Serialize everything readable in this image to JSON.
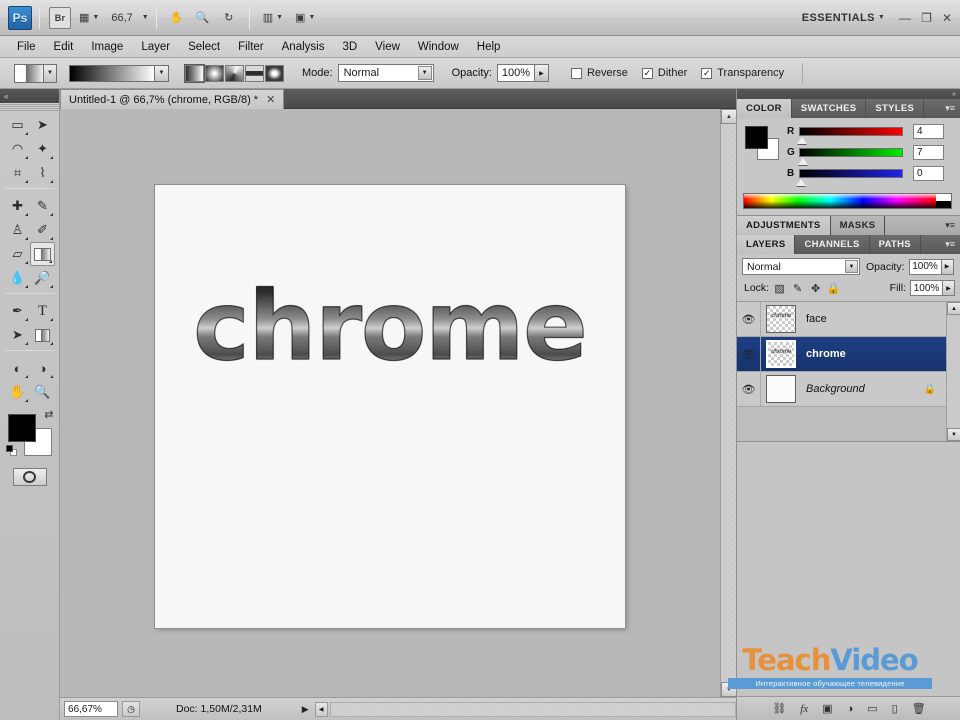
{
  "app": {
    "logo": "Ps",
    "bridge_button": "Br",
    "zoom_value": "66,7",
    "workspace": "ESSENTIALS",
    "window_controls": {
      "minimize": "—",
      "restore": "❐",
      "close": "✕"
    },
    "toolbar_icons": {
      "view_extras": "▦",
      "hand": "✋",
      "zoom": "🔍",
      "rotate": "↻",
      "arrange": "▥",
      "screen_mode": "▣"
    }
  },
  "menubar": {
    "items": [
      "File",
      "Edit",
      "Image",
      "Layer",
      "Select",
      "Filter",
      "Analysis",
      "3D",
      "View",
      "Window",
      "Help"
    ]
  },
  "options_bar": {
    "gradient_preset_label": "gradient-preset",
    "gradient_strip_label": "black-to-white-gradient",
    "gradient_types": [
      "linear",
      "radial",
      "angle",
      "reflected",
      "diamond"
    ],
    "gradient_type_selected": "linear",
    "mode_label": "Mode:",
    "mode_value": "Normal",
    "opacity_label": "Opacity:",
    "opacity_value": "100%",
    "checkboxes": [
      {
        "label": "Reverse",
        "checked": false
      },
      {
        "label": "Dither",
        "checked": true
      },
      {
        "label": "Transparency",
        "checked": true
      }
    ]
  },
  "document": {
    "tab_title": "Untitled-1 @ 66,7% (chrome, RGB/8) *",
    "close_glyph": "✕",
    "canvas_text": "chrome"
  },
  "toolbox": {
    "tools": [
      {
        "name": "rectangular-marquee",
        "glyph": "▭"
      },
      {
        "name": "move",
        "glyph": "➤"
      },
      {
        "name": "lasso",
        "glyph": "◠"
      },
      {
        "name": "magic-wand",
        "glyph": "✦"
      },
      {
        "name": "crop",
        "glyph": "⌗"
      },
      {
        "name": "eyedropper",
        "glyph": "⌇"
      },
      {
        "name": "healing-brush",
        "glyph": "✚"
      },
      {
        "name": "brush",
        "glyph": "✎"
      },
      {
        "name": "clone-stamp",
        "glyph": "♙"
      },
      {
        "name": "history-brush",
        "glyph": "✐"
      },
      {
        "name": "eraser",
        "glyph": "▱"
      },
      {
        "name": "gradient",
        "glyph": "▤"
      },
      {
        "name": "blur",
        "glyph": "💧"
      },
      {
        "name": "dodge",
        "glyph": "🔎"
      },
      {
        "name": "pen",
        "glyph": "✒"
      },
      {
        "name": "horizontal-type",
        "glyph": "T"
      },
      {
        "name": "path-selection",
        "glyph": "➤"
      },
      {
        "name": "rectangle-shape",
        "glyph": "▢"
      },
      {
        "name": "3d-rotate",
        "glyph": "◐"
      },
      {
        "name": "3d-orbit",
        "glyph": "◑"
      },
      {
        "name": "hand",
        "glyph": "✋"
      },
      {
        "name": "zoom",
        "glyph": "🔍"
      }
    ],
    "active_tool": "gradient",
    "foreground_color": "#000000",
    "background_color": "#ffffff",
    "swap_glyph": "⇄",
    "quick_mask_label": "quick-mask"
  },
  "color_panel": {
    "tabs": [
      "COLOR",
      "SWATCHES",
      "STYLES"
    ],
    "active_tab": "COLOR",
    "channels": [
      {
        "label": "R",
        "value": "4",
        "position_pct": 2
      },
      {
        "label": "G",
        "value": "7",
        "position_pct": 3
      },
      {
        "label": "B",
        "value": "0",
        "position_pct": 0
      }
    ],
    "foreground": "#000000",
    "background": "#ffffff"
  },
  "adjustments_panel": {
    "tabs": [
      "ADJUSTMENTS",
      "MASKS"
    ],
    "active_tab": "ADJUSTMENTS"
  },
  "layers_panel": {
    "tabs": [
      "LAYERS",
      "CHANNELS",
      "PATHS"
    ],
    "active_tab": "LAYERS",
    "blend_mode": "Normal",
    "opacity_label": "Opacity:",
    "opacity_value": "100%",
    "lock_label": "Lock:",
    "lock_icons": [
      "▨",
      "✎",
      "✥",
      "🔒"
    ],
    "fill_label": "Fill:",
    "fill_value": "100%",
    "layers": [
      {
        "name": "face",
        "visible": true,
        "selected": false,
        "locked": false,
        "thumb_text": "chrome",
        "thumb_type": "transparent"
      },
      {
        "name": "chrome",
        "visible": true,
        "selected": true,
        "locked": false,
        "thumb_text": "chrome",
        "thumb_type": "transparent"
      },
      {
        "name": "Background",
        "visible": true,
        "selected": false,
        "locked": true,
        "thumb_text": "",
        "thumb_type": "white"
      }
    ],
    "footer_icons": [
      "link-layers",
      "layer-style-fx",
      "layer-mask",
      "adjustment-layer",
      "new-group",
      "new-layer",
      "delete-layer"
    ],
    "footer_glyphs": [
      "⛓",
      "fx",
      "▣",
      "◑",
      "▭",
      "▯",
      "🗑"
    ]
  },
  "status_bar": {
    "zoom_value": "66,67%",
    "doc_label": "Doc: 1,50M/2,31M",
    "arrow_glyph": "▶"
  },
  "watermark": {
    "part1": "Teach",
    "part2": "Video",
    "subtitle": "Интерактивное обучающее телевидение"
  },
  "colors": {
    "app_background": "#d4d4d4",
    "canvas_background": "#b8b8b8",
    "panel_background": "#c7c7c7",
    "selected_layer": "#1e3f85",
    "artboard": "#f7f7f7",
    "watermark_orange": "#e8903a",
    "watermark_blue": "#5b9bd5"
  }
}
